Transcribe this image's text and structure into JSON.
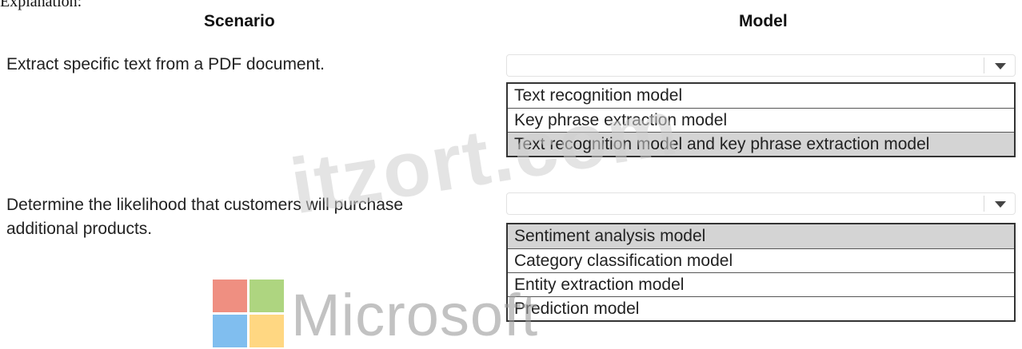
{
  "header": {
    "cut_text": "Explanation:",
    "scenario_label": "Scenario",
    "model_label": "Model"
  },
  "rows": [
    {
      "scenario_lines": [
        "Extract specific text from a PDF document."
      ],
      "options": [
        "Text recognition model",
        "Key phrase extraction model",
        "Text recognition model and key phrase extraction model"
      ],
      "selected_option": "Text recognition model and key phrase extraction model"
    },
    {
      "scenario_lines": [
        "Determine the likelihood that customers will purchase",
        "additional products."
      ],
      "options": [
        "Sentiment analysis model",
        "Category classification model",
        "Entity extraction model",
        "Prediction model"
      ],
      "selected_option": "Sentiment analysis model"
    }
  ],
  "watermark": {
    "site_text": "itzort.com",
    "brand_text": "Microsoft"
  },
  "icons": {
    "dropdown": "chevron-down-icon",
    "logo": "microsoft-logo"
  },
  "colors": {
    "selected_bg": "#d4d4d4",
    "logo_red": "#e8604c",
    "logo_green": "#8bc34a",
    "logo_blue": "#4aa3e8",
    "logo_yellow": "#ffc64d"
  }
}
